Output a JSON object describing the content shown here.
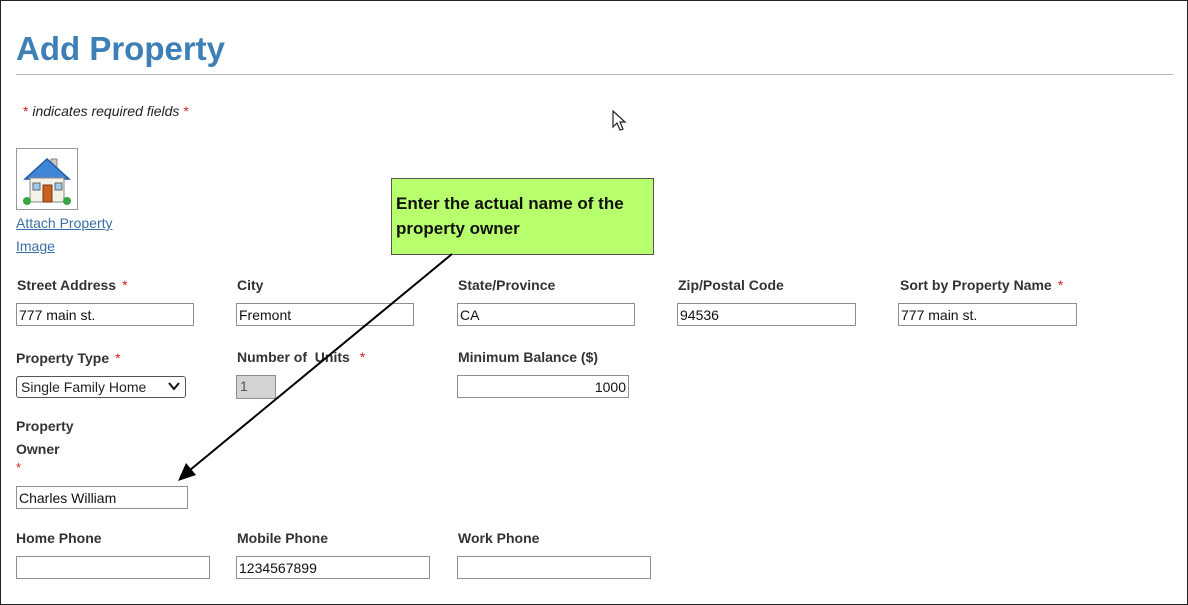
{
  "page": {
    "title": "Add Property"
  },
  "required_note": {
    "star": "*",
    "text": "indicates required fields"
  },
  "image": {
    "attach_label": "Attach Property Image"
  },
  "callout": {
    "text": "Enter the actual name of the property owner"
  },
  "fields": {
    "street_address": {
      "label": "Street Address",
      "value": "777 main st."
    },
    "city": {
      "label": "City",
      "value": "Fremont"
    },
    "state": {
      "label": "State/Province",
      "value": "CA"
    },
    "zip": {
      "label": "Zip/Postal Code",
      "value": "94536"
    },
    "sort_name": {
      "label": "Sort by Property Name",
      "value": "777 main st."
    },
    "property_type": {
      "label": "Property Type",
      "value": "Single Family Home"
    },
    "num_units": {
      "label": "Number of  Units",
      "value": "1"
    },
    "min_balance": {
      "label": "Minimum Balance ($)",
      "value": "1000"
    },
    "owner": {
      "label_line1": "Property",
      "label_line2": "Owner",
      "value": "Charles William"
    },
    "home_phone": {
      "label": "Home Phone",
      "value": ""
    },
    "mobile_phone": {
      "label": "Mobile Phone",
      "value": "1234567899"
    },
    "work_phone": {
      "label": "Work Phone",
      "value": ""
    }
  },
  "colors": {
    "title": "#3e7fb5",
    "required_star": "#d42020",
    "callout_bg": "#b8ff6e",
    "link": "#3a6ea5"
  }
}
